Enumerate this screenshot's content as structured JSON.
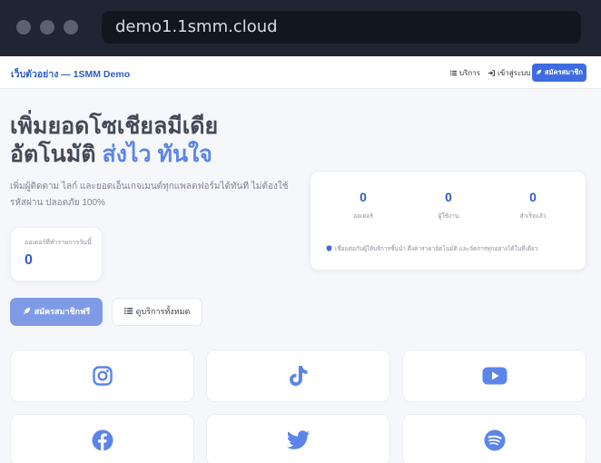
{
  "browser": {
    "url": "demo1.1smm.cloud"
  },
  "nav": {
    "brand": "เว็บตัวอย่าง — 1SMM Demo",
    "links": [
      {
        "label": "บริการ",
        "icon": "list-icon"
      },
      {
        "label": "เข้าสู่ระบบ",
        "icon": "login-icon"
      }
    ],
    "cta": "สมัครสมาชิก",
    "cta_icon": "rocket-icon"
  },
  "hero": {
    "title_line1": "เพิ่มยอดโซเชียลมีเดีย",
    "title_line2_plain": "อัตโนมัติ ",
    "title_line2_accent": "ส่งไว ทันใจ",
    "description": "เพิ่มผู้ติดตาม ไลก์ และยอดเอ็นเกจเมนต์ทุกแพลตฟอร์มได้ทันที ไม่ต้องใช้รหัสผ่าน ปลอดภัย 100%",
    "today": {
      "label": "ออเดอร์ที่ทำรายการวันนี้",
      "value": "0"
    },
    "primary_button": "สมัครสมาชิกฟรี",
    "secondary_button": "ดูบริการทั้งหมด"
  },
  "stats": {
    "items": [
      {
        "value": "0",
        "label": "ออเดอร์"
      },
      {
        "value": "0",
        "label": "ผู้ใช้งาน"
      },
      {
        "value": "0",
        "label": "สำเร็จแล้ว"
      }
    ],
    "note": "เชื่อมต่อกับผู้ให้บริการชั้นนำ ดึงค่าราคาอัตโนมัติ และจัดการทุกอย่างได้ในที่เดียว"
  },
  "platforms": [
    {
      "icon": "instagram-icon"
    },
    {
      "icon": "tiktok-icon"
    },
    {
      "icon": "youtube-icon"
    },
    {
      "icon": "facebook-icon"
    },
    {
      "icon": "twitter-icon"
    },
    {
      "icon": "spotify-icon"
    }
  ],
  "colors": {
    "accent": "#3e6be0",
    "accent_soft": "#7f9be6",
    "icon_blue": "#5b85e8",
    "chrome_bg": "#1f2533"
  }
}
